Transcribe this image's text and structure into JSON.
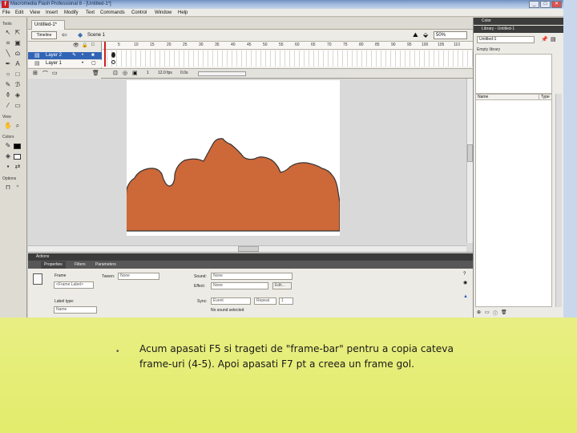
{
  "window": {
    "title": "Macromedia Flash Professional 8 - [Untitled-1*]",
    "controls": [
      "_",
      "□",
      "✕"
    ]
  },
  "menu": [
    "File",
    "Edit",
    "View",
    "Insert",
    "Modify",
    "Text",
    "Commands",
    "Control",
    "Window",
    "Help"
  ],
  "toolbox": {
    "sections": {
      "tools": "Tools",
      "view": "View",
      "colors": "Colors",
      "options": "Options"
    }
  },
  "document": {
    "tab": "Untitled-1*",
    "timeline_button": "Timeline",
    "scene": "Scene 1",
    "zoom": "50%"
  },
  "timeline": {
    "layers": [
      "Layer 2",
      "Layer 1"
    ],
    "frame_numbers": [
      "1",
      "5",
      "10",
      "15",
      "20",
      "25",
      "30",
      "35",
      "40",
      "45",
      "50",
      "55",
      "60",
      "65",
      "70",
      "75",
      "80",
      "85",
      "90",
      "95",
      "100",
      "105",
      "110"
    ],
    "fps": "12.0 fps",
    "time": "0.0s",
    "current_frame": "1"
  },
  "panels": {
    "actions": "Actions",
    "tabs": [
      "Properties",
      "Filters",
      "Parameters"
    ],
    "color": "Color",
    "library": "Library - Untitled-1"
  },
  "properties": {
    "frame_label": "Frame",
    "frame_value": "<Frame Label>",
    "tween_label": "Tween:",
    "tween_value": "None",
    "sound_label": "Sound:",
    "sound_value": "None",
    "effect_label": "Effect:",
    "effect_value": "None",
    "edit_button": "Edit...",
    "sync_label": "Sync:",
    "sync_value": "Event",
    "repeat_label": "Repeat",
    "repeat_value": "1",
    "no_sound": "No sound selected",
    "label_type": "Label type:",
    "label_type_value": "Name"
  },
  "library": {
    "document": "Untitled-1",
    "status": "Empty library",
    "columns": [
      "Name",
      "Type"
    ]
  },
  "caption": {
    "bullet": "•",
    "text": "Acum apasati F5 si trageti de \"frame-bar\" pentru a copia cateva frame-uri (4-5). Apoi apasati F7 pt a creea un frame gol."
  },
  "colors": {
    "shape_fill": "#cd6839",
    "stroke": "#333333",
    "slide_bg_top": "#f7f7c4",
    "slide_bg_bottom": "#e3ec6c"
  }
}
